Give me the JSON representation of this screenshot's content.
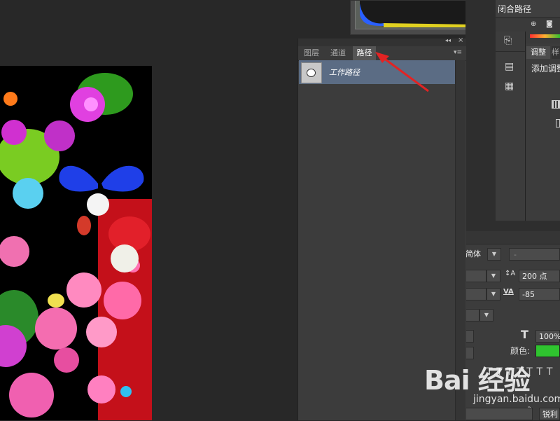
{
  "panel_tabs": [
    "图层",
    "通道",
    "路径"
  ],
  "path_item": "工作路径",
  "close_path_label": "闭合路径",
  "adjust_tab": "调整",
  "adjust_tab2": "样",
  "add_adjust": "添加调整",
  "font_style": "简体",
  "font_size_dash": "-",
  "leading": "200 点",
  "tracking": "-85",
  "scale": "100%",
  "color_label": "颜色:",
  "color_value": "#2fc42f",
  "antialias": "锐利",
  "aa_icon": "a",
  "watermark": "Bai 经验",
  "watermark_url": "jingyan.baidu.com"
}
